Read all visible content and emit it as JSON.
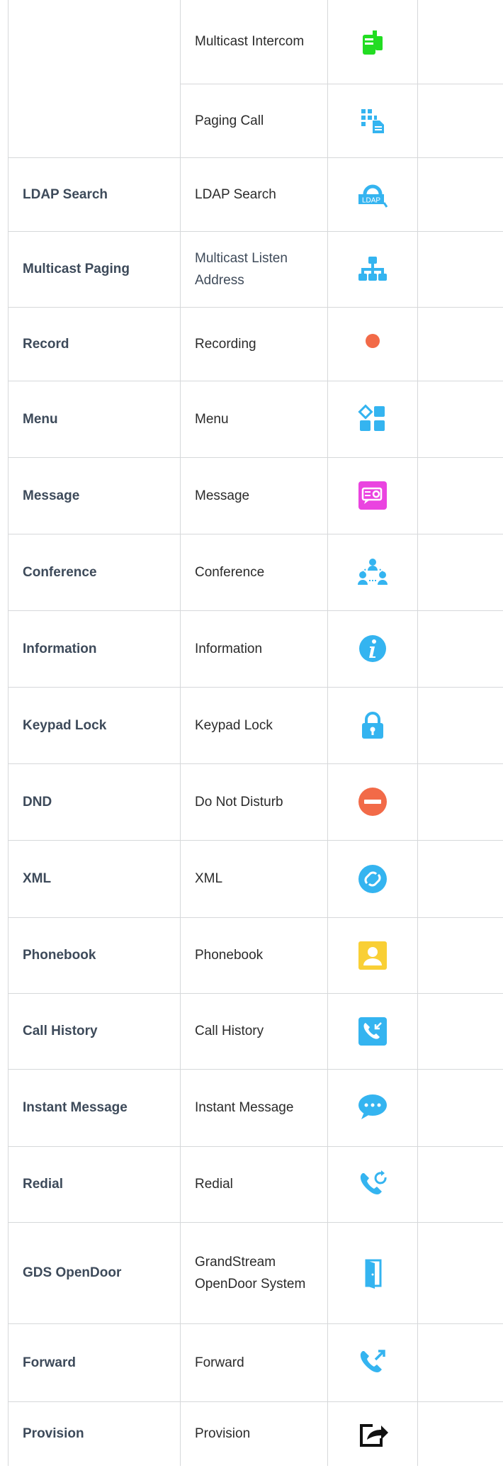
{
  "rows": [
    {
      "col1": "",
      "col2": "Multicast Intercom",
      "icon": "multicast-intercom-icon"
    },
    {
      "col1": "",
      "col2": "Paging Call",
      "icon": "paging-call-icon"
    },
    {
      "col1": "LDAP Search",
      "col2": "LDAP Search",
      "icon": "ldap-search-icon"
    },
    {
      "col1": "Multicast Paging",
      "col2": "Multicast Listen Address",
      "icon": "multicast-listen-address-icon"
    },
    {
      "col1": "Record",
      "col2": "Recording",
      "icon": "recording-icon"
    },
    {
      "col1": "Menu",
      "col2": "Menu",
      "icon": "menu-icon"
    },
    {
      "col1": "Message",
      "col2": "Message",
      "icon": "message-icon"
    },
    {
      "col1": "Conference",
      "col2": "Conference",
      "icon": "conference-icon"
    },
    {
      "col1": "Information",
      "col2": "Information",
      "icon": "information-icon"
    },
    {
      "col1": "Keypad Lock",
      "col2": "Keypad Lock",
      "icon": "keypad-lock-icon"
    },
    {
      "col1": "DND",
      "col2": "Do Not Disturb",
      "icon": "do-not-disturb-icon"
    },
    {
      "col1": "XML",
      "col2": "XML",
      "icon": "xml-icon"
    },
    {
      "col1": "Phonebook",
      "col2": "Phonebook",
      "icon": "phonebook-icon"
    },
    {
      "col1": "Call History",
      "col2": "Call History",
      "icon": "call-history-icon"
    },
    {
      "col1": "Instant Message",
      "col2": "Instant Message",
      "icon": "instant-message-icon"
    },
    {
      "col1": "Redial",
      "col2": "Redial",
      "icon": "redial-icon"
    },
    {
      "col1": "GDS OpenDoor",
      "col2": "GrandStream OpenDoor System",
      "icon": "gds-opendoor-icon"
    },
    {
      "col1": "Forward",
      "col2": "Forward",
      "icon": "forward-icon"
    },
    {
      "col1": "Provision",
      "col2": "Provision",
      "icon": "provision-icon"
    }
  ],
  "colors": {
    "border": "#d6d8da",
    "icon_blue": "#34b4f0",
    "icon_green": "#22dd22",
    "icon_red": "#f26a48",
    "icon_magenta": "#ea44e0",
    "icon_yellow": "#f9cf35",
    "icon_black": "#111111"
  }
}
